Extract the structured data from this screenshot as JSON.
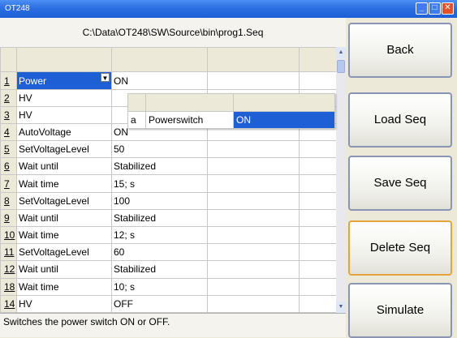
{
  "window": {
    "title": "OT248",
    "controls": {
      "minimize": "_",
      "maximize": "□",
      "close": "✕"
    }
  },
  "path": "C:\\Data\\OT248\\SW\\Source\\bin\\prog1.Seq",
  "table": {
    "rows": [
      {
        "num": "1",
        "cmd": "Power",
        "value": "ON",
        "selected": true
      },
      {
        "num": "2",
        "cmd": "HV",
        "value": ""
      },
      {
        "num": "3",
        "cmd": "HV",
        "value": ""
      },
      {
        "num": "4",
        "cmd": "AutoVoltage",
        "value": "ON"
      },
      {
        "num": "5",
        "cmd": "SetVoltageLevel",
        "value": "50"
      },
      {
        "num": "6",
        "cmd": "Wait until",
        "value": "Stabilized"
      },
      {
        "num": "7",
        "cmd": "Wait time",
        "value": "15; s"
      },
      {
        "num": "8",
        "cmd": "SetVoltageLevel",
        "value": "100"
      },
      {
        "num": "9",
        "cmd": "Wait until",
        "value": "Stabilized"
      },
      {
        "num": "10",
        "cmd": "Wait time",
        "value": "12; s"
      },
      {
        "num": "11",
        "cmd": "SetVoltageLevel",
        "value": "60"
      },
      {
        "num": "12",
        "cmd": "Wait until",
        "value": "Stabilized"
      },
      {
        "num": "18",
        "cmd": "Wait time",
        "value": "10; s"
      },
      {
        "num": "14",
        "cmd": "HV",
        "value": "OFF"
      }
    ],
    "dropdown_icon": "dropdown-arrow-icon"
  },
  "popup": {
    "letter": "a",
    "name": "Powerswitch",
    "value": "ON"
  },
  "status_text": "Switches the power switch ON or OFF.",
  "buttons": {
    "back": "Back",
    "load": "Load Seq",
    "save": "Save Seq",
    "delete": "Delete Seq",
    "simulate": "Simulate"
  },
  "colors": {
    "titlebar": "#2b6fe2",
    "selection": "#1f5fd6",
    "active_button_border": "#e7a43c"
  }
}
